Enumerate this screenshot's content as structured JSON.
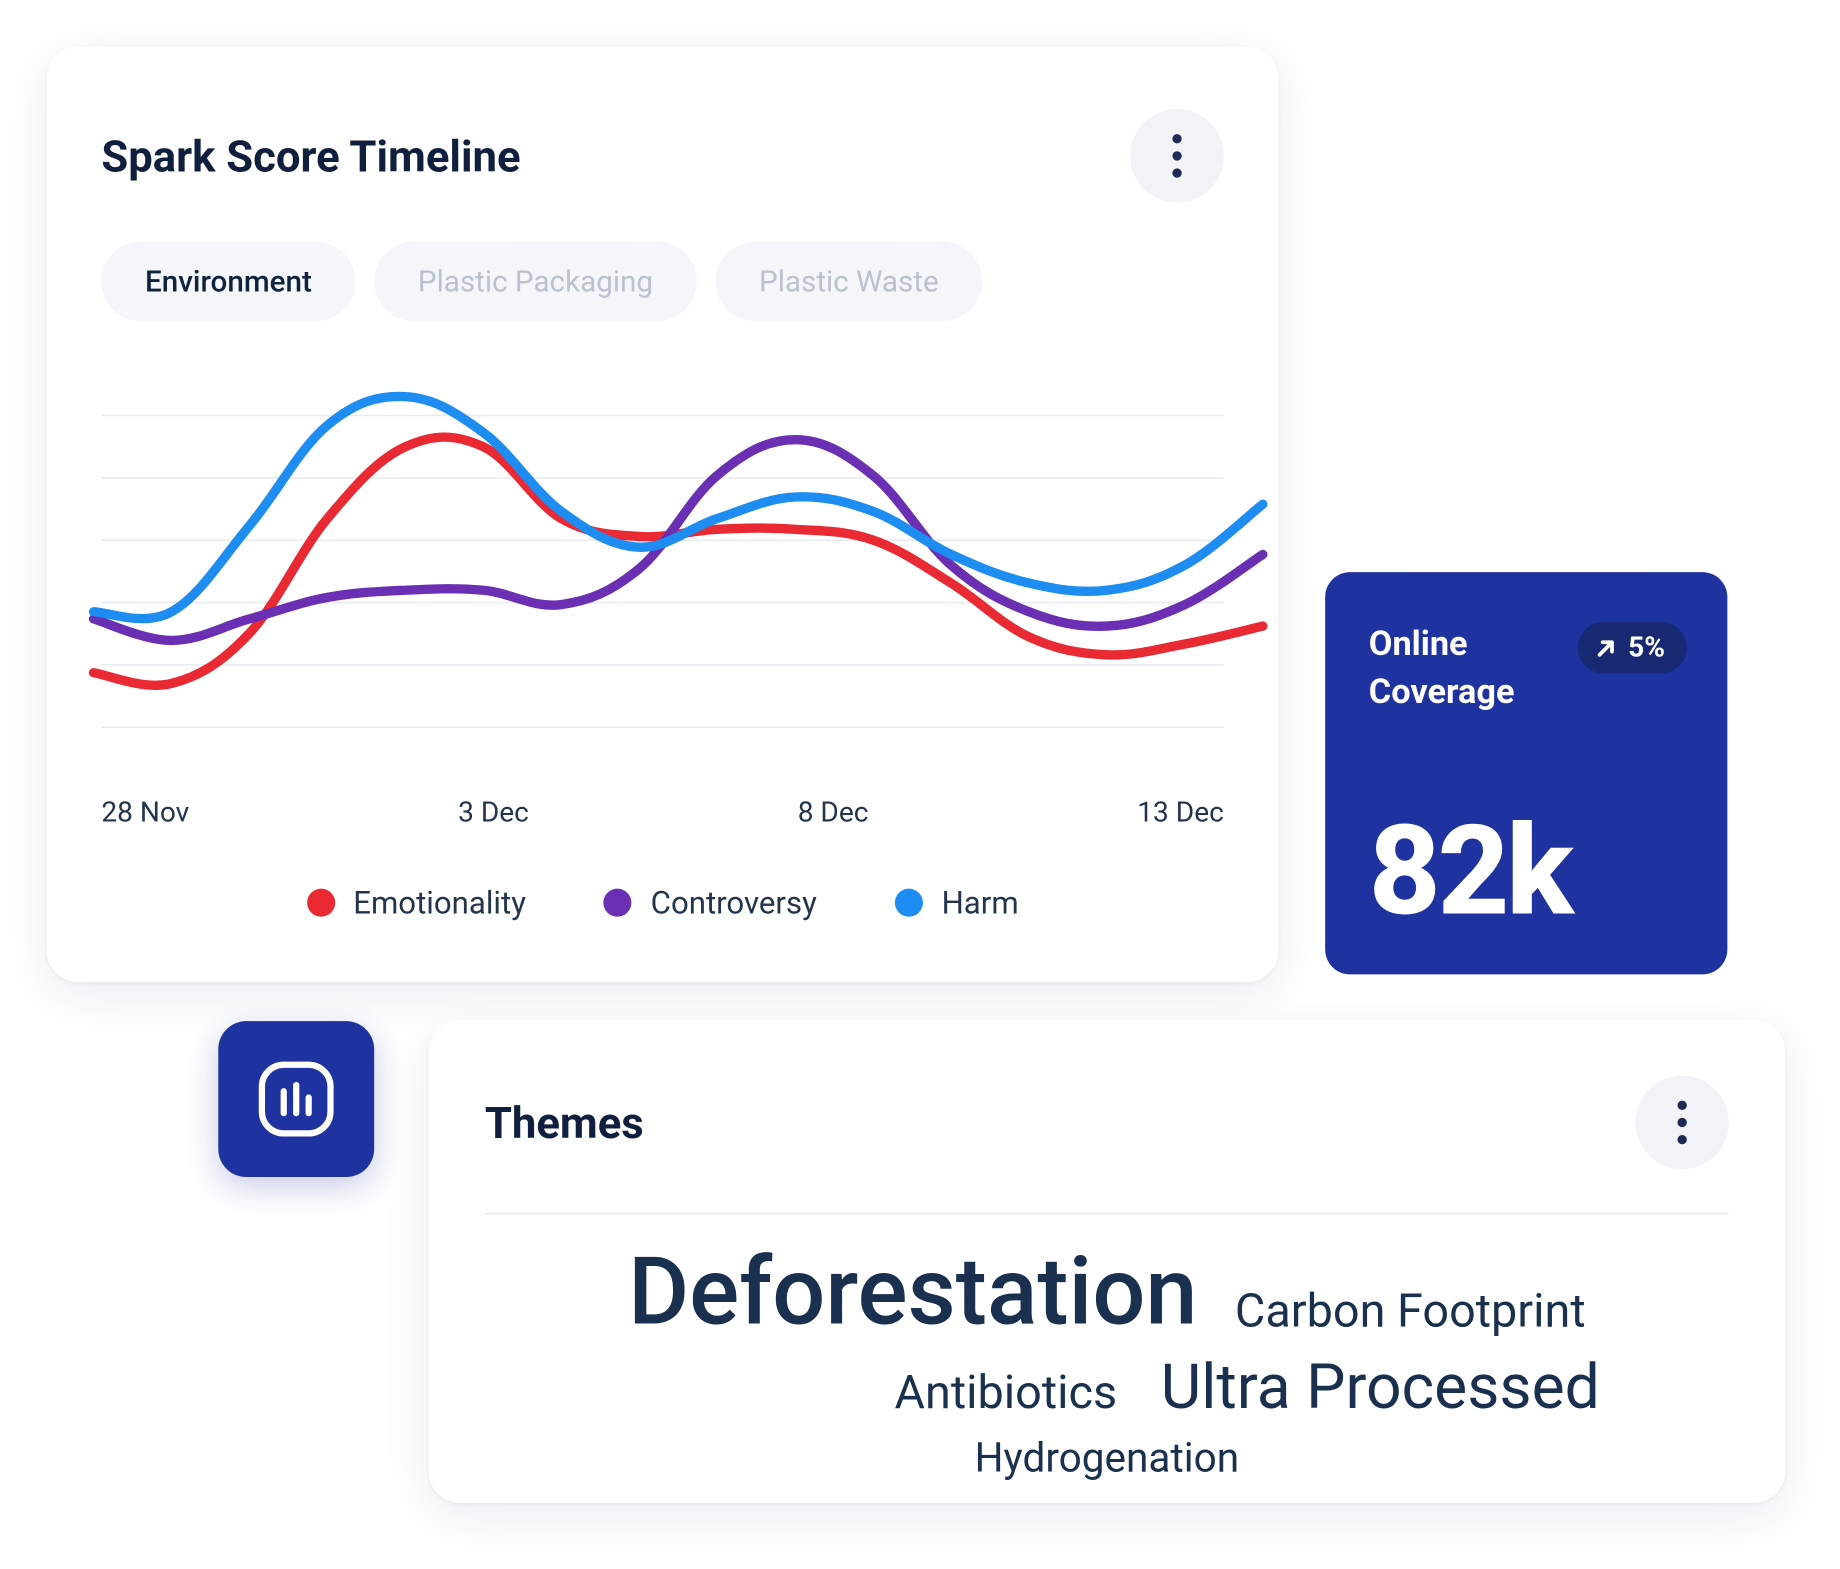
{
  "timeline": {
    "title": "Spark Score Timeline",
    "tabs": [
      {
        "label": "Environment",
        "active": true
      },
      {
        "label": "Plastic Packaging",
        "active": false
      },
      {
        "label": "Plastic Waste",
        "active": false
      }
    ],
    "x_ticks": [
      "28 Nov",
      "3 Dec",
      "8 Dec",
      "13 Dec"
    ],
    "legend": [
      {
        "label": "Emotionality",
        "color": "#ea2a33"
      },
      {
        "label": "Controversy",
        "color": "#6b2fb3"
      },
      {
        "label": "Harm",
        "color": "#1e8df2"
      }
    ]
  },
  "coverage": {
    "label_line1": "Online",
    "label_line2": "Coverage",
    "trend": "5%",
    "trend_direction": "up",
    "value": "82k"
  },
  "themes": {
    "title": "Themes",
    "words": [
      {
        "text": "Deforestation",
        "weight": 100
      },
      {
        "text": "Carbon Footprint",
        "weight": 45
      },
      {
        "text": "Antibiotics",
        "weight": 45
      },
      {
        "text": "Ultra Processed",
        "weight": 70
      },
      {
        "text": "Hydrogenation",
        "weight": 40
      }
    ]
  },
  "colors": {
    "brand": "#1f33a0",
    "text_dark": "#0f1f3d"
  },
  "chart_data": {
    "type": "line",
    "title": "Spark Score Timeline",
    "xlabel": "",
    "ylabel": "",
    "ylim": [
      0,
      100
    ],
    "x": [
      "28 Nov",
      "29 Nov",
      "30 Nov",
      "1 Dec",
      "2 Dec",
      "3 Dec",
      "4 Dec",
      "5 Dec",
      "6 Dec",
      "7 Dec",
      "8 Dec",
      "9 Dec",
      "10 Dec",
      "11 Dec",
      "12 Dec",
      "13 Dec"
    ],
    "series": [
      {
        "name": "Emotionality",
        "color": "#ea2a33",
        "values": [
          15,
          12,
          26,
          58,
          78,
          78,
          58,
          53,
          55,
          55,
          52,
          40,
          25,
          20,
          23,
          28
        ]
      },
      {
        "name": "Controversy",
        "color": "#6b2fb3",
        "values": [
          30,
          24,
          30,
          36,
          38,
          38,
          34,
          44,
          70,
          80,
          70,
          45,
          32,
          28,
          34,
          48
        ]
      },
      {
        "name": "Harm",
        "color": "#1e8df2",
        "values": [
          32,
          32,
          56,
          84,
          92,
          82,
          60,
          50,
          58,
          64,
          60,
          48,
          40,
          38,
          45,
          62
        ]
      }
    ],
    "grid": true,
    "legend_position": "bottom"
  }
}
